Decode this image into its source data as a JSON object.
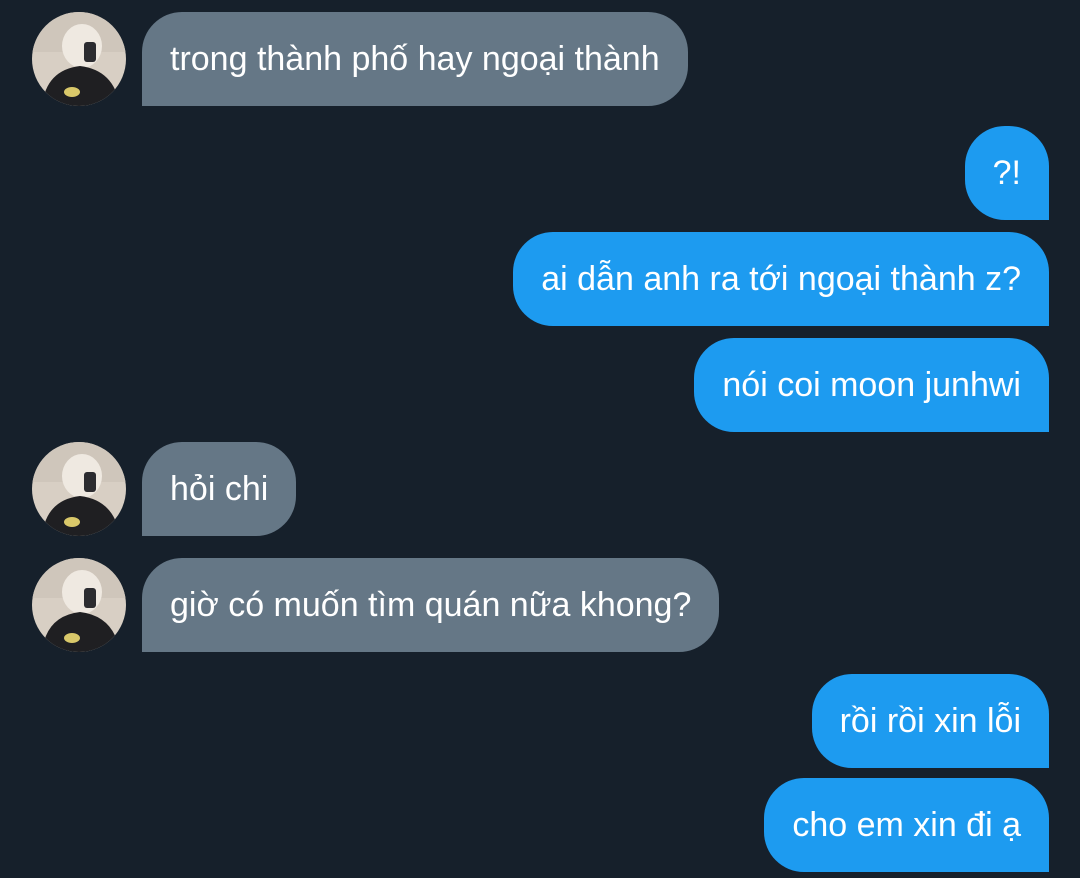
{
  "messages": [
    {
      "side": "received",
      "text": "trong thành phố hay ngoại thành"
    },
    {
      "side": "sent",
      "text": "?!"
    },
    {
      "side": "sent",
      "text": "ai dẫn anh ra tới ngoại thành z?"
    },
    {
      "side": "sent",
      "text": "nói coi moon junhwi"
    },
    {
      "side": "received",
      "text": "hỏi chi"
    },
    {
      "side": "received",
      "text": "giờ có muốn tìm quán nữa khong?"
    },
    {
      "side": "sent",
      "text": "rồi rồi xin lỗi"
    },
    {
      "side": "sent",
      "text": "cho em xin đi ạ"
    }
  ],
  "colors": {
    "background": "#16202b",
    "received_bubble": "#657786",
    "sent_bubble": "#1d9bf0",
    "text": "#ffffff"
  },
  "icons": {
    "avatar": "contact-avatar-icon"
  }
}
